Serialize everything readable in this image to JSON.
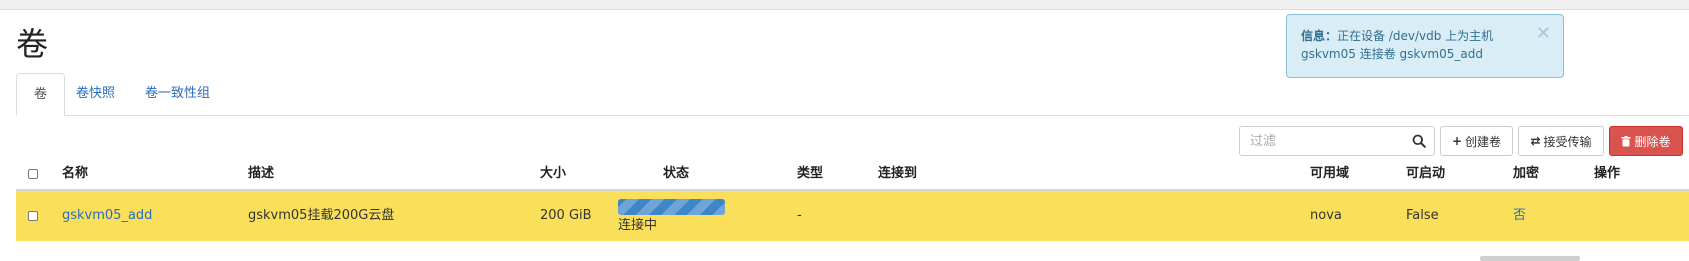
{
  "page": {
    "title": "卷"
  },
  "tabs": [
    {
      "label": "卷",
      "active": true
    },
    {
      "label": "卷快照",
      "active": false
    },
    {
      "label": "卷一致性组",
      "active": false
    }
  ],
  "toolbar": {
    "filter_placeholder": "过滤",
    "search_icon": "search-icon",
    "create_label": "创建卷",
    "create_icon": "plus-icon",
    "accept_label": "接受传输",
    "accept_icon": "transfer-icon",
    "delete_label": "删除卷",
    "delete_icon": "trash-icon",
    "delete_color": "#d9534f"
  },
  "table": {
    "columns": [
      "名称",
      "描述",
      "大小",
      "状态",
      "类型",
      "连接到",
      "可用域",
      "可启动",
      "加密",
      "操作"
    ],
    "rows": [
      {
        "name": "gskvm05_add",
        "description": "gskvm05挂载200G云盘",
        "size": "200 GiB",
        "status": "连接中",
        "type": "-",
        "attached_to": "",
        "availability_zone": "nova",
        "bootable": "False",
        "encrypted": "否",
        "row_color": "#fae05a"
      }
    ]
  },
  "toast": {
    "heading": "信息：",
    "message": "正在设备 /dev/vdb 上为主机 gskvm05 连接卷 gskvm05_add",
    "close_icon": "close-icon",
    "background": "#d9edf7"
  },
  "colors": {
    "link": "#2a6ebb",
    "progress": "#3d87c9"
  }
}
